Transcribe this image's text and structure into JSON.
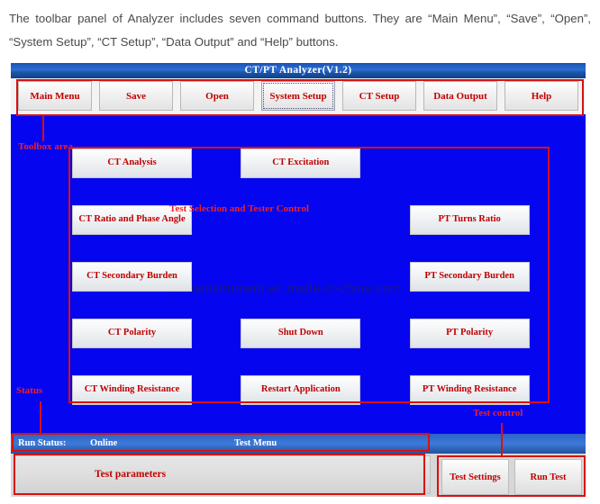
{
  "caption": {
    "text": "The toolbar panel of Analyzer includes seven command buttons. They are “Main Menu”, “Save”, “Open”, “System Setup”, “CT Setup”, “Data Output” and “Help” buttons."
  },
  "window": {
    "title": "CT/PT Analyzer(V1.2)",
    "background_color": "#0505F0",
    "titlebar_color": "#2A6FD0"
  },
  "toolbar": {
    "buttons": [
      {
        "label": "Main Menu",
        "focused": false
      },
      {
        "label": "Save",
        "focused": false
      },
      {
        "label": "Open",
        "focused": false
      },
      {
        "label": "System Setup",
        "focused": true
      },
      {
        "label": "CT Setup",
        "focused": false
      },
      {
        "label": "Data Output",
        "focused": false
      },
      {
        "label": "Help",
        "focused": false
      }
    ]
  },
  "test_panel": {
    "caption": "Test Selection and Tester Control",
    "rows": [
      [
        {
          "label": "CT Analysis",
          "empty": false
        },
        {
          "label": "CT Excitation",
          "empty": false
        },
        {
          "label": "",
          "empty": true
        }
      ],
      [
        {
          "label": "CT Ratio and Phase Angle",
          "empty": false
        },
        {
          "label": "",
          "empty": true
        },
        {
          "label": "PT Turns Ratio",
          "empty": false
        }
      ],
      [
        {
          "label": "CT Secondary Burden",
          "empty": false
        },
        {
          "label": "",
          "empty": true
        },
        {
          "label": "PT Secondary Burden",
          "empty": false
        }
      ],
      [
        {
          "label": "CT Polarity",
          "empty": false
        },
        {
          "label": "Shut Down",
          "empty": false
        },
        {
          "label": "PT Polarity",
          "empty": false
        }
      ],
      [
        {
          "label": "CT Winding Resistance",
          "empty": false
        },
        {
          "label": "Restart Application",
          "empty": false
        },
        {
          "label": "PT Winding Resistance",
          "empty": false
        }
      ]
    ]
  },
  "status_bar": {
    "run_status_label": "Run Status:",
    "run_status_value": "Online",
    "test_menu_label": "Test Menu"
  },
  "bottom": {
    "parameters_label": "Test parameters",
    "buttons": [
      {
        "label": "Test Settings"
      },
      {
        "label": "Run Test"
      }
    ]
  },
  "annotations": {
    "color": "#D81010",
    "toolbox_area": "Toolbox area",
    "status": "Status",
    "test_control": "Test control"
  },
  "watermark": {
    "text": "chinainstrument.en.made-in-china.com"
  }
}
